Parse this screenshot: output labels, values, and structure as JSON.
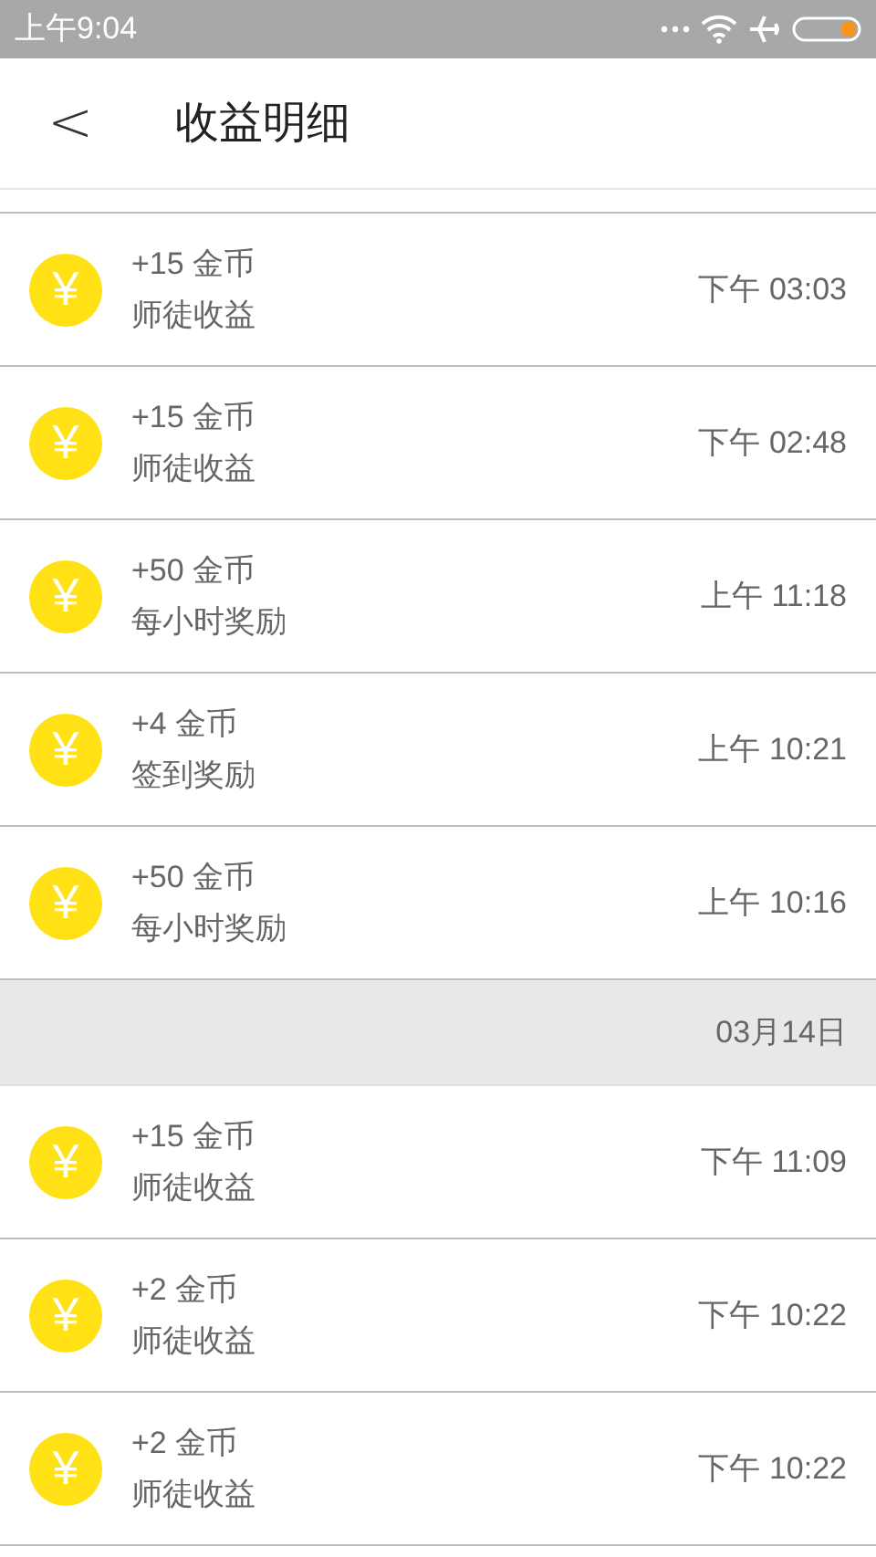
{
  "status_bar": {
    "time": "上午9:04"
  },
  "header": {
    "back": "<",
    "title": "收益明细"
  },
  "items": [
    {
      "kind": "record",
      "icon": "¥",
      "amount": "+15 金币",
      "source": "师徒收益",
      "time": "下午 03:03"
    },
    {
      "kind": "record",
      "icon": "¥",
      "amount": "+15 金币",
      "source": "师徒收益",
      "time": "下午 02:48"
    },
    {
      "kind": "record",
      "icon": "¥",
      "amount": "+50 金币",
      "source": "每小时奖励",
      "time": "上午 11:18"
    },
    {
      "kind": "record",
      "icon": "¥",
      "amount": "+4 金币",
      "source": "签到奖励",
      "time": "上午 10:21"
    },
    {
      "kind": "record",
      "icon": "¥",
      "amount": "+50 金币",
      "source": "每小时奖励",
      "time": "上午 10:16"
    },
    {
      "kind": "date",
      "label": "03月14日"
    },
    {
      "kind": "record",
      "icon": "¥",
      "amount": "+15 金币",
      "source": "师徒收益",
      "time": "下午 11:09"
    },
    {
      "kind": "record",
      "icon": "¥",
      "amount": "+2 金币",
      "source": "师徒收益",
      "time": "下午 10:22"
    },
    {
      "kind": "record",
      "icon": "¥",
      "amount": "+2 金币",
      "source": "师徒收益",
      "time": "下午 10:22"
    }
  ]
}
